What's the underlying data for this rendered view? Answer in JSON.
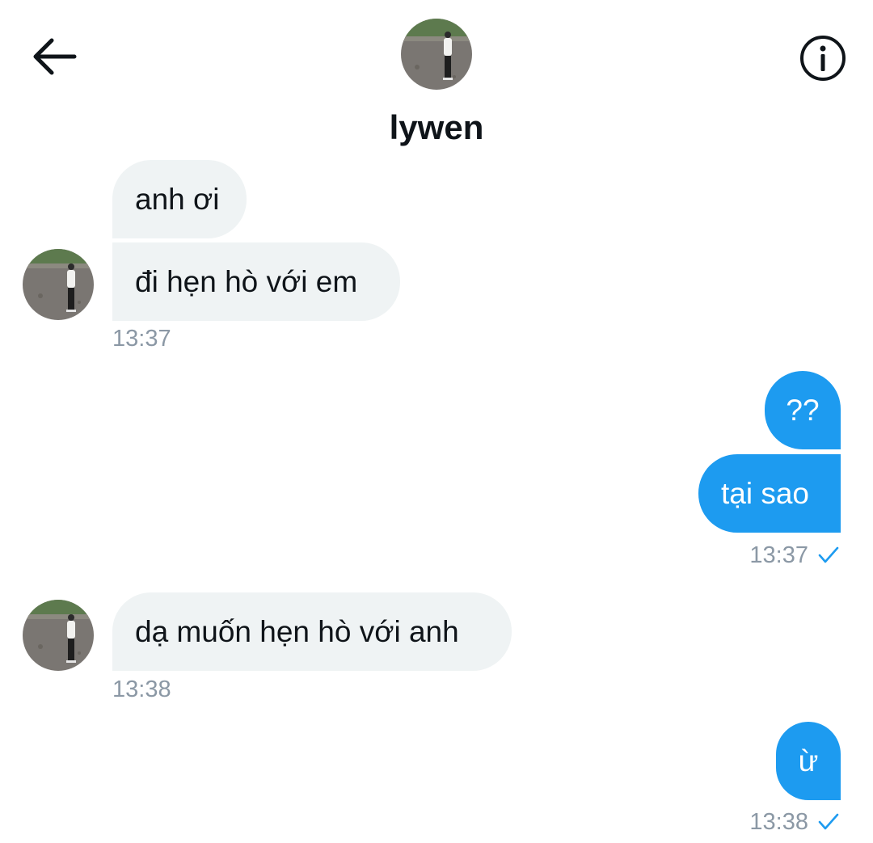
{
  "header": {
    "contact_name": "lywen",
    "back_icon": "arrow-left-icon",
    "info_icon": "info-circle-icon"
  },
  "colors": {
    "outgoing_bubble": "#1d9bf0",
    "incoming_bubble": "#eff3f4",
    "timestamp": "#8b98a5",
    "read_check": "#1d9bf0"
  },
  "messages": {
    "m1": {
      "direction": "incoming",
      "text": "anh ơi"
    },
    "m2": {
      "direction": "incoming",
      "text": "đi hẹn hò với em"
    },
    "m3": {
      "direction": "outgoing",
      "text": "??"
    },
    "m4": {
      "direction": "outgoing",
      "text": "tại sao"
    },
    "m5": {
      "direction": "incoming",
      "text": "dạ muốn hẹn hò với anh"
    },
    "m6": {
      "direction": "outgoing",
      "text": "ừ"
    }
  },
  "timestamps": {
    "t1": "13:37",
    "t2": "13:37",
    "t3": "13:38",
    "t4": "13:38"
  },
  "status_icon": "check-icon"
}
